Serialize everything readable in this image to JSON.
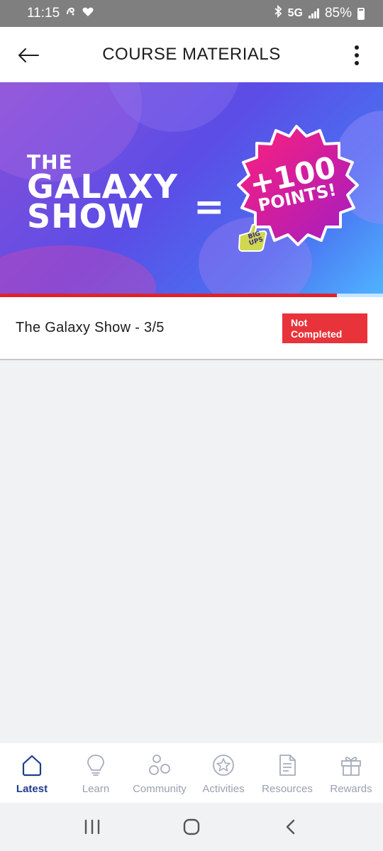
{
  "status_bar": {
    "time": "11:15",
    "network": "5G",
    "battery": "85%"
  },
  "app_bar": {
    "title": "COURSE MATERIALS"
  },
  "banner": {
    "title_line1": "THE",
    "title_line2": "GALAXY",
    "title_line3": "SHOW",
    "equals": "=",
    "points_line1": "+100",
    "points_line2": "POINTS!",
    "sticker_line1": "BIG",
    "sticker_line2": "UPS"
  },
  "progress": {
    "fraction": 0.88
  },
  "course_item": {
    "title": "The Galaxy Show - 3/5",
    "status": "Not Completed"
  },
  "bottom_nav": {
    "items": [
      {
        "label": "Latest",
        "icon": "home-icon",
        "active": true
      },
      {
        "label": "Learn",
        "icon": "lightbulb-icon",
        "active": false
      },
      {
        "label": "Community",
        "icon": "community-icon",
        "active": false
      },
      {
        "label": "Activities",
        "icon": "star-badge-icon",
        "active": false
      },
      {
        "label": "Resources",
        "icon": "document-icon",
        "active": false
      },
      {
        "label": "Rewards",
        "icon": "gift-icon",
        "active": false
      }
    ]
  },
  "colors": {
    "accent_active": "#1f3b8f",
    "inactive": "#9aa0b0",
    "status_red": "#e8333a",
    "progress_red": "#e0212b"
  }
}
